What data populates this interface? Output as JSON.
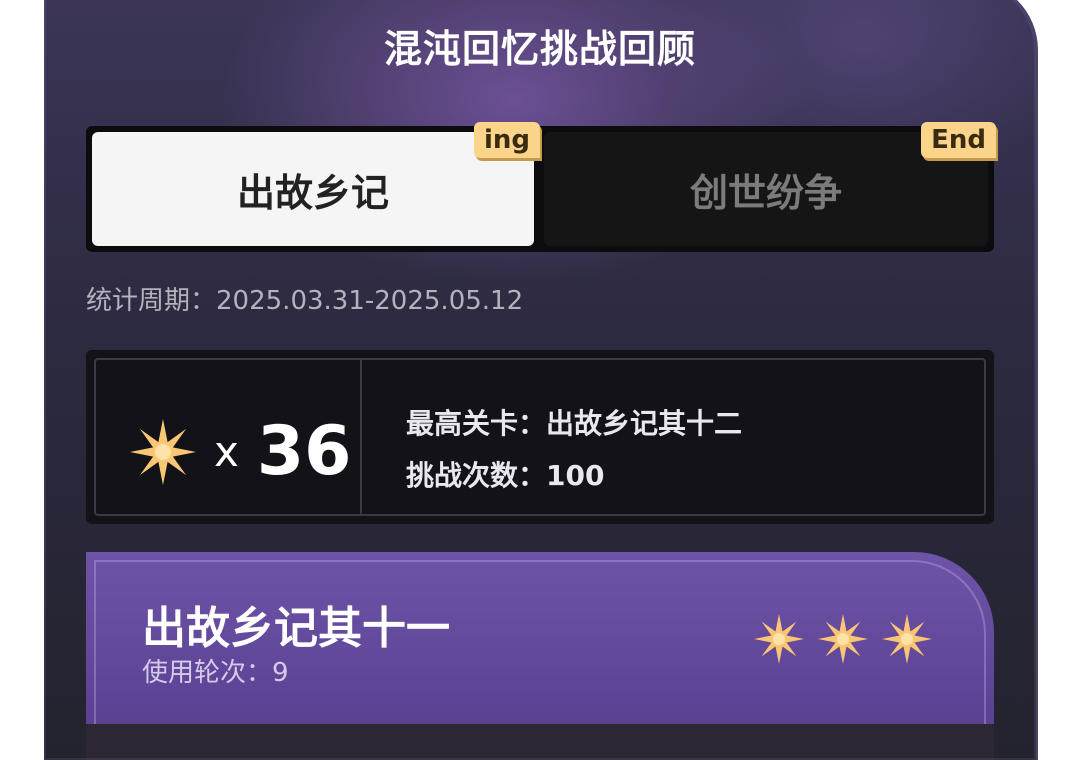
{
  "page": {
    "title": "混沌回忆挑战回顾"
  },
  "tabs": [
    {
      "label": "出故乡记",
      "badge": "ing",
      "active": true
    },
    {
      "label": "创世纷争",
      "badge": "End",
      "active": false
    }
  ],
  "period": {
    "label": "统计周期：",
    "value": "2025.03.31-2025.05.12"
  },
  "stats": {
    "star_icon": "eight-point-star-icon",
    "x_mark": "x",
    "star_count": "36",
    "highest_level_label": "最高关卡：",
    "highest_level_value": "出故乡记其十二",
    "attempts_label": "挑战次数：",
    "attempts_value": "100"
  },
  "level_card": {
    "name": "出故乡记其十一",
    "rounds_label": "使用轮次：",
    "rounds_value": "9",
    "stars_earned": 3
  },
  "colors": {
    "star": "#f9c774",
    "badge": "#f9d48a",
    "card_purple": "#5f4597",
    "tab_active_bg": "#f5f5f5",
    "tab_inactive_bg": "#151515"
  }
}
